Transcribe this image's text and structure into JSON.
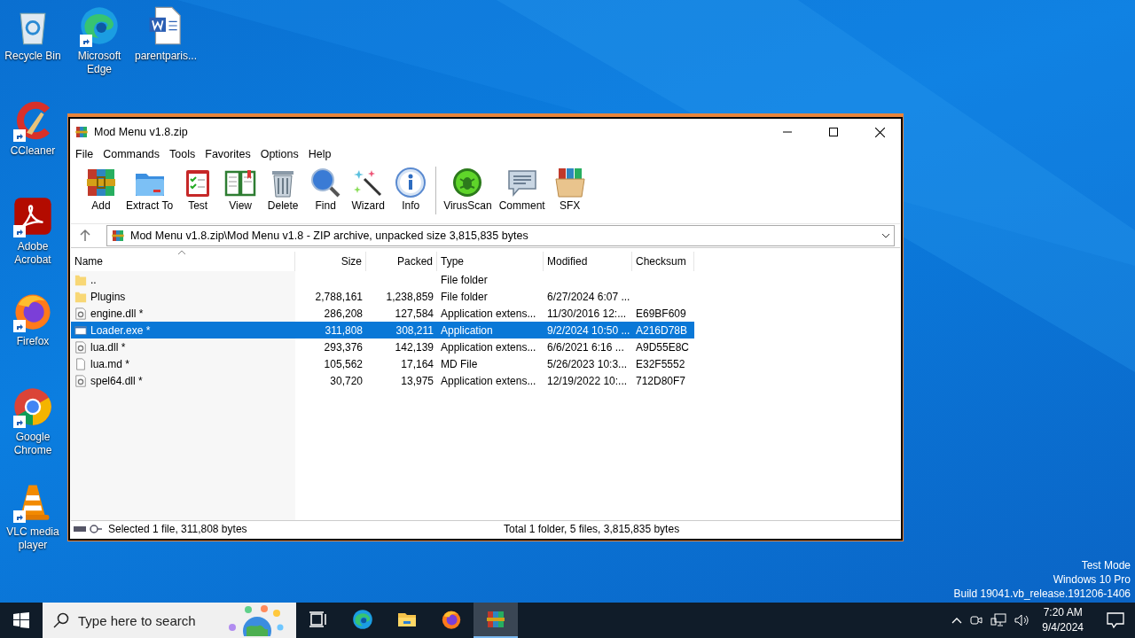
{
  "desktop_icons": [
    {
      "label": "Recycle Bin",
      "kind": "recycle",
      "shortcut": false
    },
    {
      "label": "Microsoft Edge",
      "kind": "edge",
      "shortcut": true
    },
    {
      "label": "parentparis...",
      "kind": "word",
      "shortcut": false
    },
    {
      "label": "CCleaner",
      "kind": "ccleaner",
      "shortcut": true
    },
    {
      "label": "Adobe Acrobat",
      "kind": "acrobat",
      "shortcut": true
    },
    {
      "label": "Firefox",
      "kind": "firefox",
      "shortcut": true
    },
    {
      "label": "Google Chrome",
      "kind": "chrome",
      "shortcut": true
    },
    {
      "label": "VLC media player",
      "kind": "vlc",
      "shortcut": true
    }
  ],
  "window": {
    "title": "Mod Menu v1.8.zip",
    "menu": [
      "File",
      "Commands",
      "Tools",
      "Favorites",
      "Options",
      "Help"
    ],
    "toolbar_groups": [
      [
        {
          "label": "Add",
          "kind": "add"
        },
        {
          "label": "Extract To",
          "kind": "extract"
        },
        {
          "label": "Test",
          "kind": "test"
        },
        {
          "label": "View",
          "kind": "view"
        },
        {
          "label": "Delete",
          "kind": "delete"
        },
        {
          "label": "Find",
          "kind": "find"
        },
        {
          "label": "Wizard",
          "kind": "wizard"
        },
        {
          "label": "Info",
          "kind": "info"
        }
      ],
      [
        {
          "label": "VirusScan",
          "kind": "virus"
        },
        {
          "label": "Comment",
          "kind": "comment"
        },
        {
          "label": "SFX",
          "kind": "sfx"
        }
      ]
    ],
    "address": "Mod Menu v1.8.zip\\Mod Menu v1.8 - ZIP archive, unpacked size 3,815,835 bytes",
    "columns": [
      {
        "label": "Name",
        "sorted": true
      },
      {
        "label": "Size",
        "sorted": false
      },
      {
        "label": "Packed",
        "sorted": false
      },
      {
        "label": "Type",
        "sorted": false
      },
      {
        "label": "Modified",
        "sorted": false
      },
      {
        "label": "Checksum",
        "sorted": false
      }
    ],
    "rows": [
      {
        "kind": "folder",
        "name": "..",
        "size": "",
        "packed": "",
        "type": "File folder",
        "modified": "",
        "checksum": "",
        "selected": false
      },
      {
        "kind": "folder",
        "name": "Plugins",
        "size": "2,788,161",
        "packed": "1,238,859",
        "type": "File folder",
        "modified": "6/27/2024 6:07 ...",
        "checksum": "",
        "selected": false
      },
      {
        "kind": "dll",
        "name": "engine.dll *",
        "size": "286,208",
        "packed": "127,584",
        "type": "Application extens...",
        "modified": "11/30/2016 12:...",
        "checksum": "E69BF609",
        "selected": false
      },
      {
        "kind": "exe",
        "name": "Loader.exe *",
        "size": "311,808",
        "packed": "308,211",
        "type": "Application",
        "modified": "9/2/2024 10:50 ...",
        "checksum": "A216D78B",
        "selected": true
      },
      {
        "kind": "dll",
        "name": "lua.dll *",
        "size": "293,376",
        "packed": "142,139",
        "type": "Application extens...",
        "modified": "6/6/2021 6:16 ...",
        "checksum": "A9D55E8C",
        "selected": false
      },
      {
        "kind": "file",
        "name": "lua.md *",
        "size": "105,562",
        "packed": "17,164",
        "type": "MD File",
        "modified": "5/26/2023 10:3...",
        "checksum": "E32F5552",
        "selected": false
      },
      {
        "kind": "dll",
        "name": "spel64.dll *",
        "size": "30,720",
        "packed": "13,975",
        "type": "Application extens...",
        "modified": "12/19/2022 10:...",
        "checksum": "712D80F7",
        "selected": false
      }
    ],
    "status_bar": {
      "left": "Selected 1 file, 311,808 bytes",
      "right": "Total 1 folder, 5 files, 3,815,835 bytes"
    }
  },
  "watermark": [
    "Test Mode",
    "Windows 10 Pro",
    "Build 19041.vb_release.191206-1406"
  ],
  "taskbar": {
    "search_placeholder": "Type here to search",
    "apps": [
      {
        "kind": "taskview",
        "active": false
      },
      {
        "kind": "edge",
        "active": false
      },
      {
        "kind": "explorer",
        "active": false
      },
      {
        "kind": "firefox",
        "active": false
      },
      {
        "kind": "winrar",
        "active": true
      }
    ],
    "time": "7:20 AM",
    "date": "9/4/2024"
  }
}
